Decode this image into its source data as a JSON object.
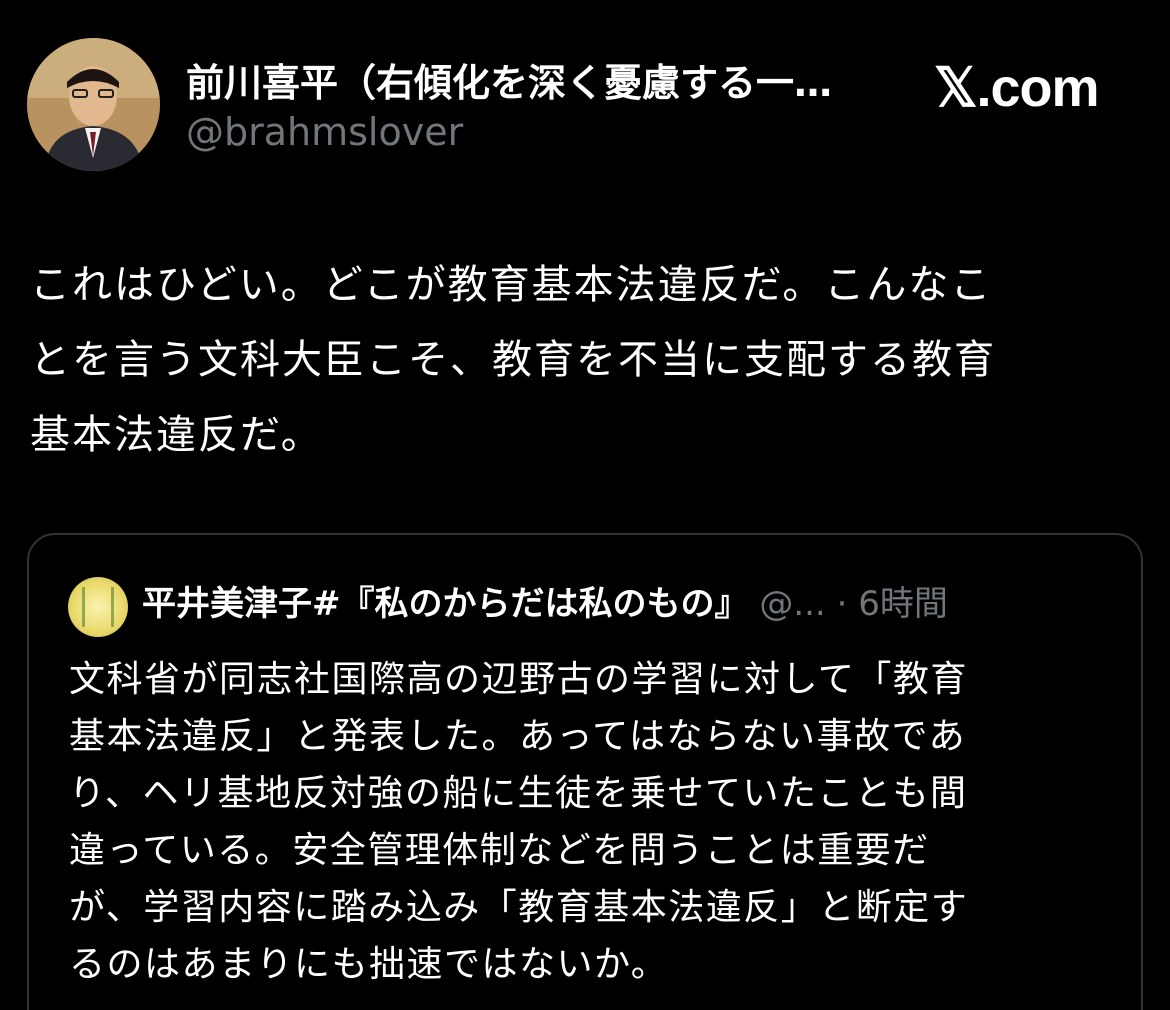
{
  "author": {
    "display_name": "前川喜平（右傾化を深く憂慮する一…",
    "handle": "@brahmslover"
  },
  "brand": "𝕏.com",
  "post": {
    "text": "これはひどい。どこが教育基本法違反だ。こんなこ\nとを言う文科大臣こそ、教育を不当に支配する教育\n基本法違反だ。"
  },
  "quote": {
    "display_name": "平井美津子#『私のからだは私のもの』",
    "handle_truncated": "@...",
    "separator": " · ",
    "time": "6時間",
    "text": "文科省が同志社国際高の辺野古の学習に対して「教育\n基本法違反」と発表した。あってはならない事故であ\nり、ヘリ基地反対強の船に生徒を乗せていたことも間\n違っている。安全管理体制などを問うことは重要だ\nが、学習内容に踏み込み「教育基本法違反」と断定す\nるのはあまりにも拙速ではないか。"
  }
}
